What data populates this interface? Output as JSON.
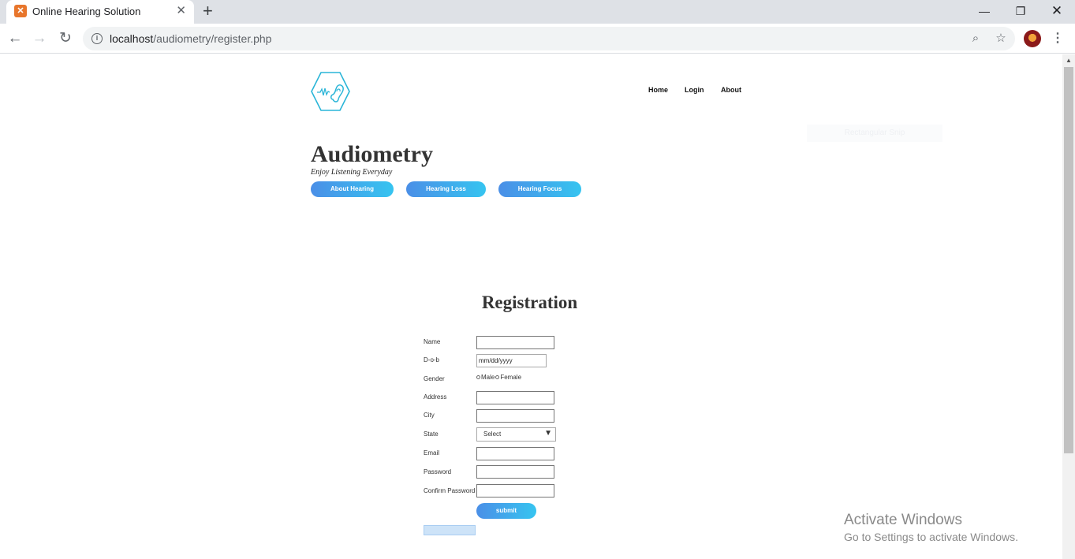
{
  "browser": {
    "tab_title": "Online Hearing Solution",
    "tab_favicon_icon": "xampp-icon",
    "new_tab": "+",
    "url_host": "localhost",
    "url_path": "/audiometry/register.php"
  },
  "site": {
    "brand": "Audiometry",
    "tagline": "Enjoy Listening Everyday",
    "logo_icon": "ear-hexagon-icon",
    "nav": [
      "Home",
      "Login",
      "About"
    ],
    "pills": [
      "About Hearing",
      "Hearing Loss",
      "Hearing Focus"
    ],
    "ghost_text": "Rectangular Snip"
  },
  "form": {
    "title": "Registration",
    "labels": {
      "name": "Name",
      "dob": "D-o-b",
      "gender": "Gender",
      "address": "Address",
      "city": "City",
      "state": "State",
      "email": "Email",
      "password": "Password",
      "confirm_password": "Confirm Password"
    },
    "dob_value": "mm/dd/yyyy",
    "gender_options": [
      "Male",
      "Female"
    ],
    "state_selected": "Select",
    "submit_label": "submit"
  },
  "watermark": {
    "line1": "Activate Windows",
    "line2": "Go to Settings to activate Windows."
  },
  "colors": {
    "accent_start": "#4a8fe7",
    "accent_end": "#36c4f0",
    "logo": "#2ab5d8"
  }
}
